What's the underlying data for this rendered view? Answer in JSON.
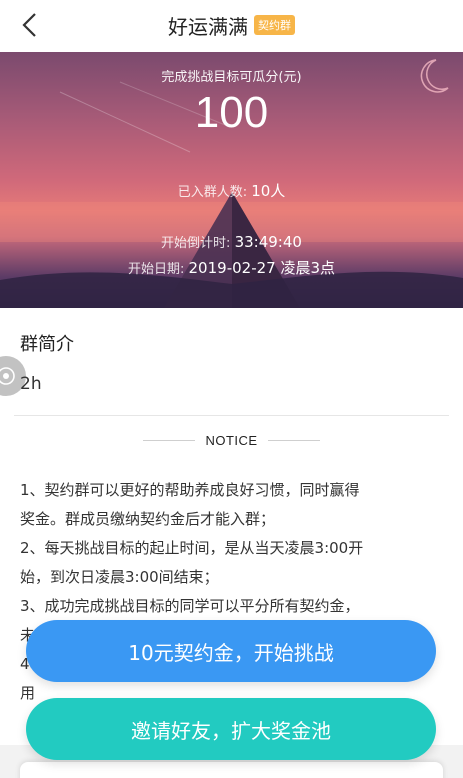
{
  "header": {
    "title": "好运满满",
    "badge": "契约群"
  },
  "hero": {
    "subtitle": "完成挑战目标可瓜分(元)",
    "amount": "100",
    "members_label": "已入群人数:",
    "members_value": "10人",
    "countdown_label": "开始倒计时:",
    "countdown_value": "33:49:40",
    "start_label": "开始日期:",
    "start_value": "2019-02-27 凌晨3点"
  },
  "intro": {
    "title": "群简介",
    "text": "2h"
  },
  "notice": {
    "label": "NOTICE"
  },
  "rules": [
    "1、契约群可以更好的帮助养成良好习惯，同时赢得",
    "奖金。群成员缴纳契约金后才能入群；",
    "2、每天挑战目标的起止时间，是从当天凌晨3:00开",
    "始，到次日凌晨3:00间结束；",
    "3、成功完成挑战目标的同学可以平分所有契约金，",
    "未",
    "4、",
    "用"
  ],
  "buttons": {
    "join": "10元契约金，开始挑战",
    "invite": "邀请好友，扩大奖金池"
  },
  "colors": {
    "badge": "#f7b548",
    "join_button": "#3a98f3",
    "invite_button": "#22cbc1"
  }
}
